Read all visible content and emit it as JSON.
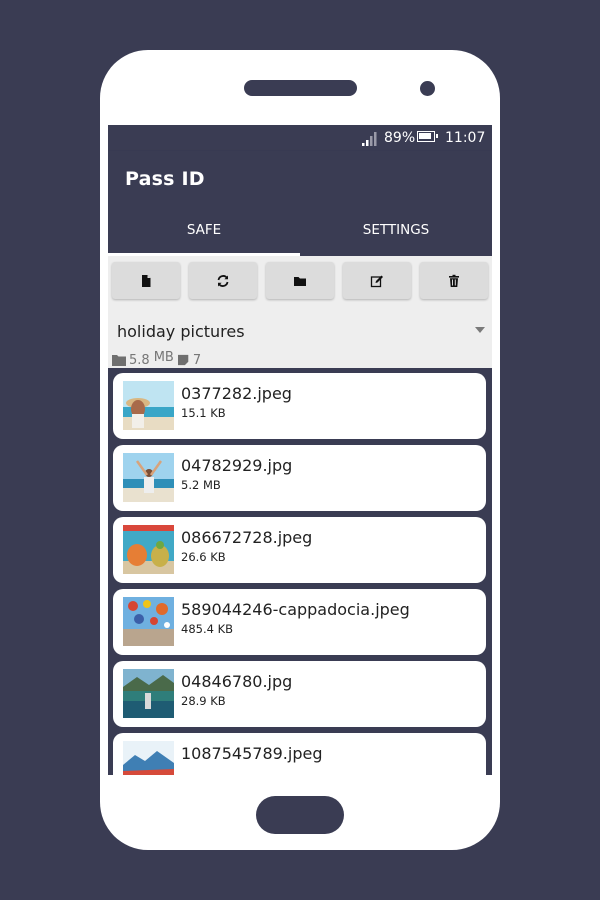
{
  "status_bar": {
    "battery": "89%",
    "battery_level": 0.89,
    "time": "11:07"
  },
  "app": {
    "title": "Pass ID"
  },
  "tabs": [
    {
      "label": "SAFE",
      "active": true
    },
    {
      "label": "SETTINGS",
      "active": false
    }
  ],
  "toolbar": {
    "buttons": [
      {
        "icon": "file-icon"
      },
      {
        "icon": "refresh-icon"
      },
      {
        "icon": "folder-icon"
      },
      {
        "icon": "edit-icon"
      },
      {
        "icon": "trash-icon"
      }
    ]
  },
  "folder": {
    "name": "holiday pictures",
    "size_value": "5.8",
    "size_unit": "MB",
    "count": "7"
  },
  "files": [
    {
      "name": "0377282.jpeg",
      "size": "15.1 KB"
    },
    {
      "name": "04782929.jpg",
      "size": "5.2 MB"
    },
    {
      "name": "086672728.jpeg",
      "size": "26.6 KB"
    },
    {
      "name": "589044246-cappadocia.jpeg",
      "size": "485.4 KB"
    },
    {
      "name": "04846780.jpg",
      "size": "28.9 KB"
    },
    {
      "name": "1087545789.jpeg",
      "size": ""
    }
  ],
  "colors": {
    "background": "#3a3c53",
    "primary": "#3a3c53",
    "panel": "#eeeeee",
    "button": "#dcdcdc"
  }
}
